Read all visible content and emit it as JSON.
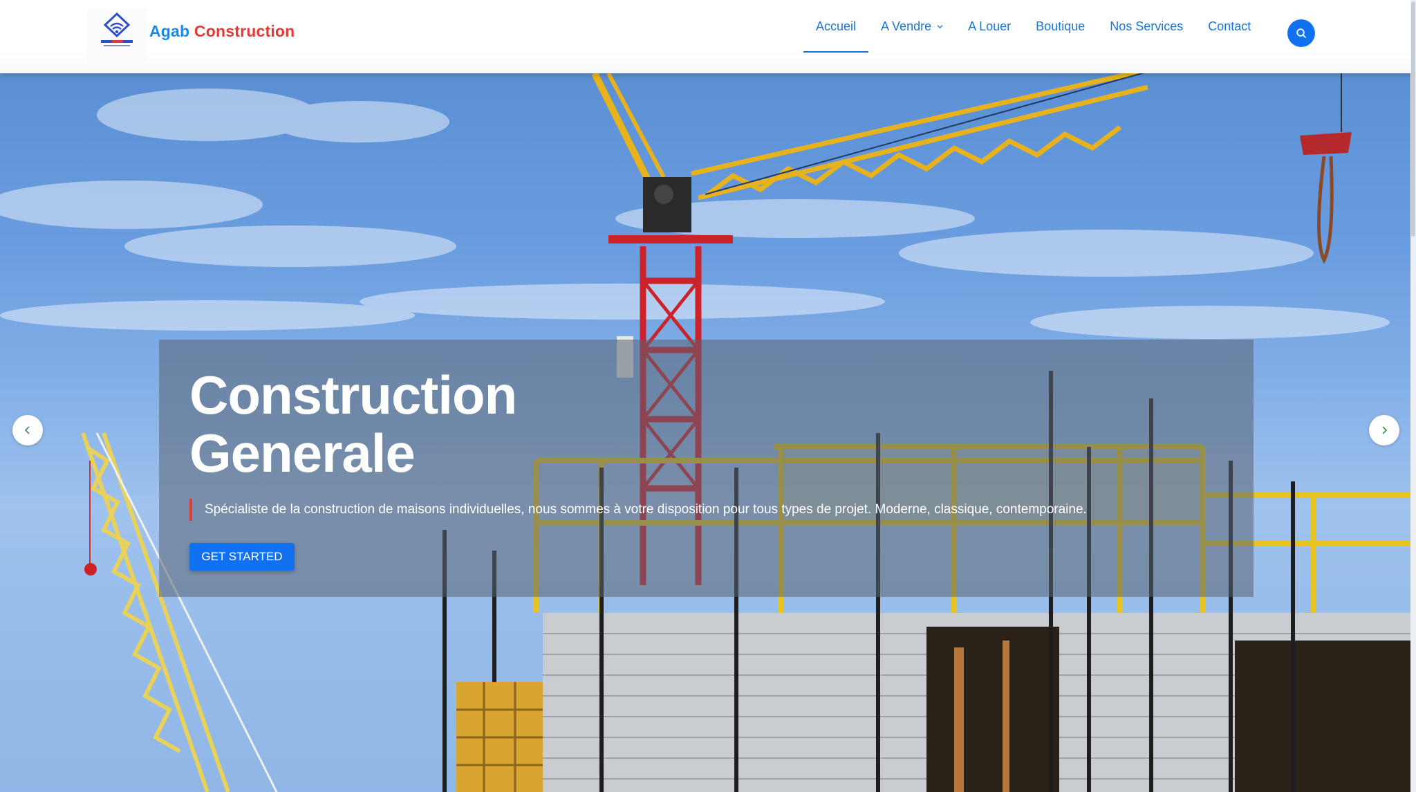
{
  "brand": {
    "name_part1": "Agab",
    "name_part2": "Construction",
    "colors": {
      "part1": "#1e88e5",
      "part2": "#e53935"
    }
  },
  "nav": {
    "items": [
      {
        "label": "Accueil",
        "active": true
      },
      {
        "label": "A Vendre",
        "has_dropdown": true
      },
      {
        "label": "A Louer"
      },
      {
        "label": "Boutique"
      },
      {
        "label": "Nos Services"
      },
      {
        "label": "Contact"
      }
    ],
    "search_icon": "search-icon"
  },
  "hero": {
    "title_line1": "Construction",
    "title_line2": "Generale",
    "description": "Spécialiste de la construction de maisons individuelles, nous sommes à votre disposition pour tous types de projet. Moderne, classique, contemporaine.",
    "cta_label": "GET STARTED",
    "prev_icon": "chevron-left-icon",
    "next_icon": "chevron-right-icon"
  },
  "colors": {
    "accent": "#1271f0",
    "nav_text": "#1976d2",
    "desc_bar": "#e53935"
  }
}
